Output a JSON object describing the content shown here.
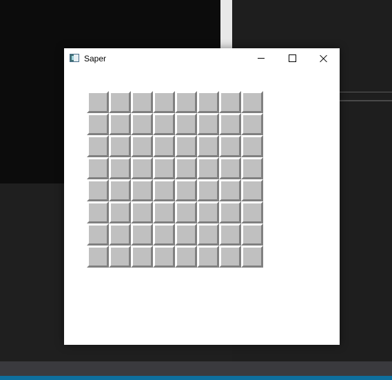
{
  "window": {
    "title": "Saper",
    "controls": {
      "minimize": "minimize-icon",
      "maximize": "maximize-icon",
      "close": "close-icon"
    }
  },
  "board": {
    "rows": 8,
    "cols": 8,
    "cell_state": "covered",
    "cell_color": "#c0c0c0"
  }
}
